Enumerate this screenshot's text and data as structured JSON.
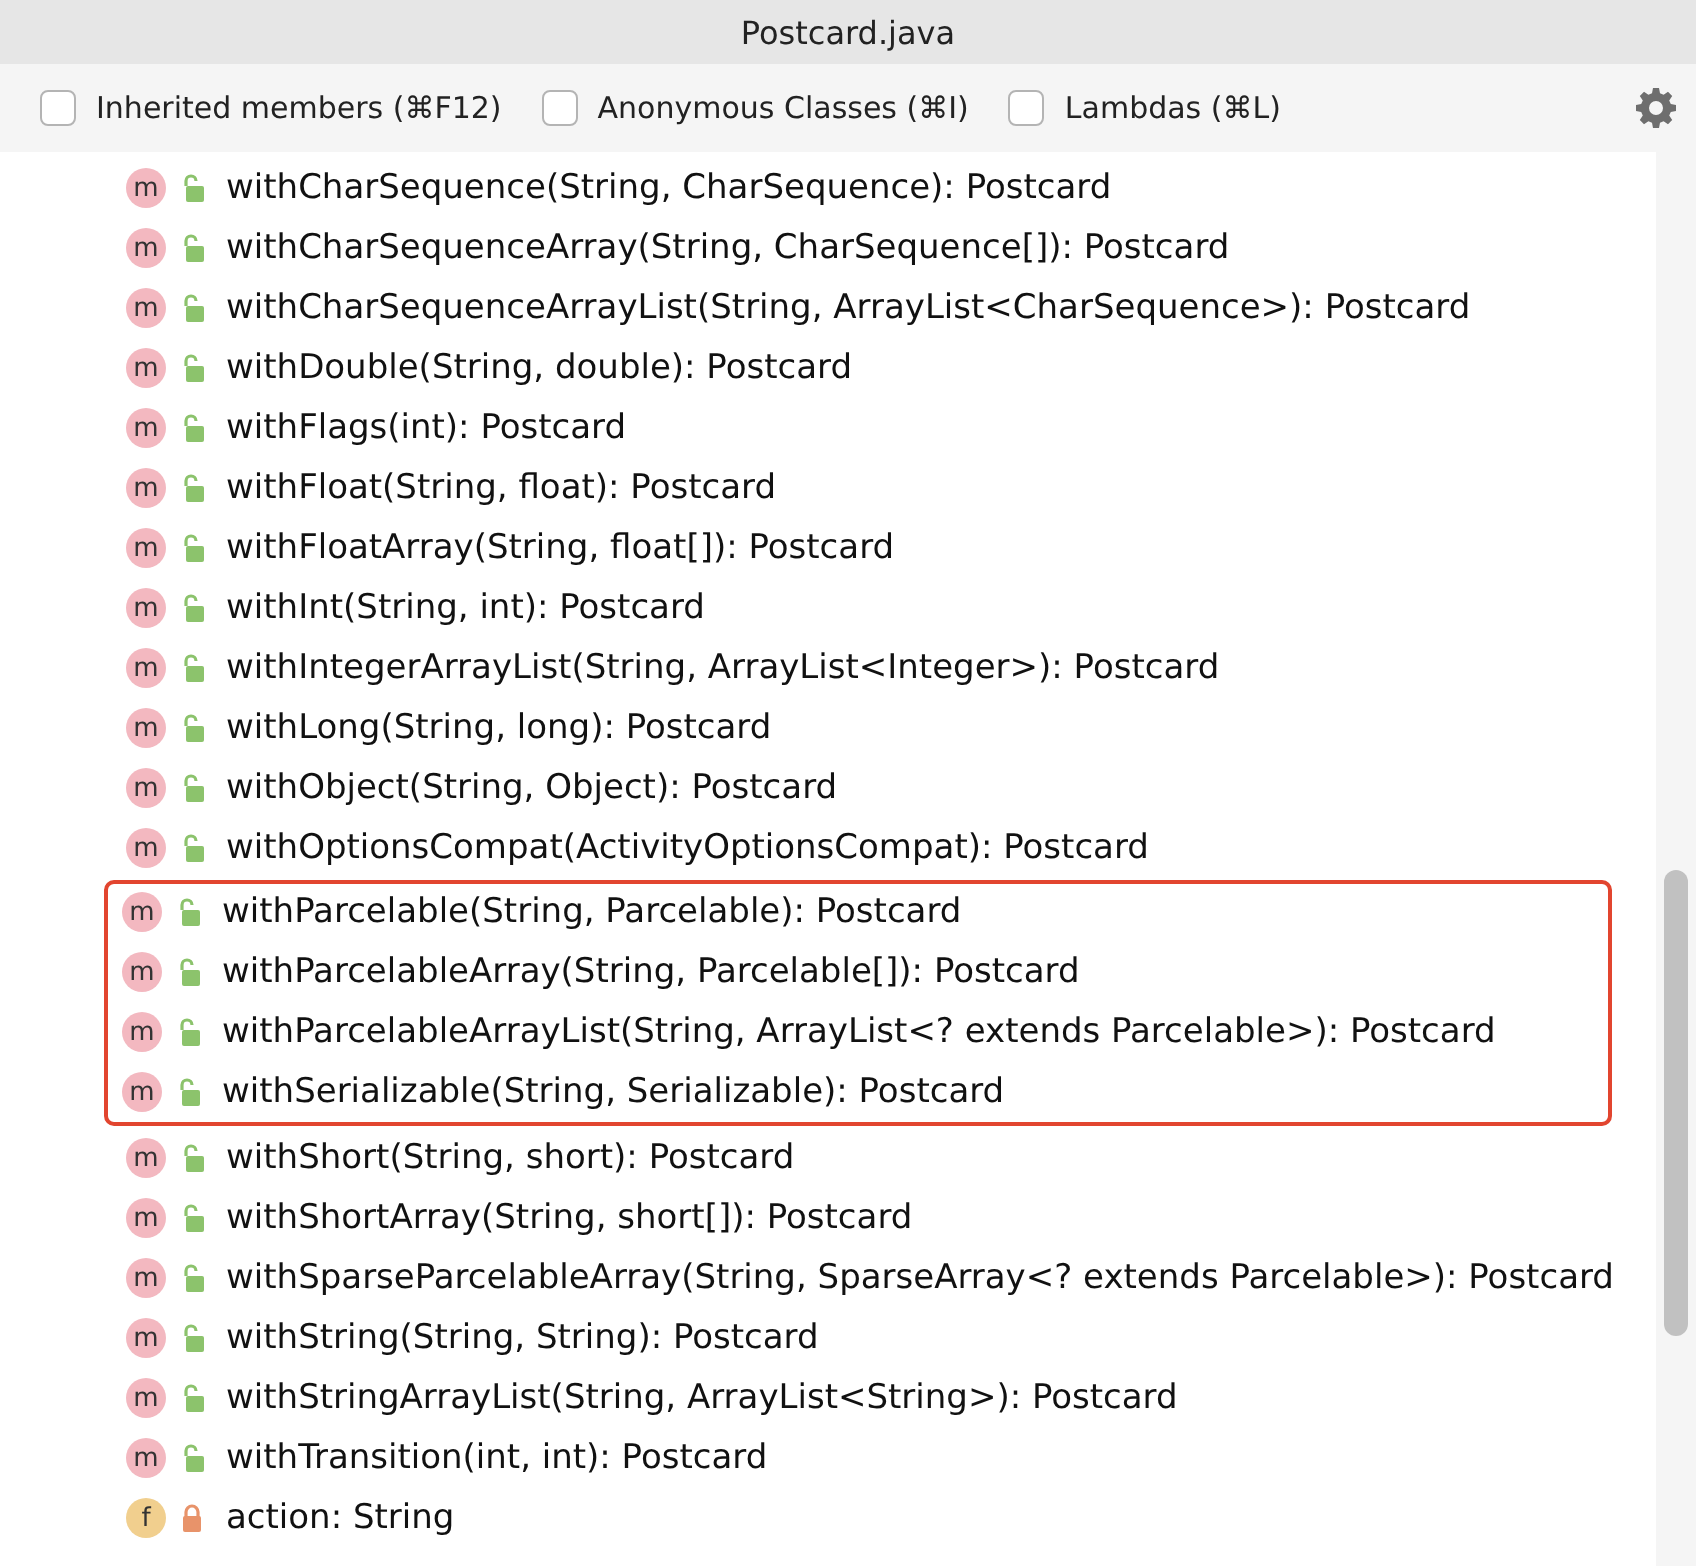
{
  "window": {
    "title": "Postcard.java"
  },
  "toolbar": {
    "options": [
      {
        "label": "Inherited members (⌘F12)",
        "checked": false
      },
      {
        "label": "Anonymous Classes (⌘I)",
        "checked": false
      },
      {
        "label": "Lambdas (⌘L)",
        "checked": false
      }
    ]
  },
  "members": [
    {
      "kind": "method",
      "badge": "m",
      "locked": false,
      "signature": "withCharSequence(String, CharSequence): Postcard",
      "highlighted": false
    },
    {
      "kind": "method",
      "badge": "m",
      "locked": false,
      "signature": "withCharSequenceArray(String, CharSequence[]): Postcard",
      "highlighted": false
    },
    {
      "kind": "method",
      "badge": "m",
      "locked": false,
      "signature": "withCharSequenceArrayList(String, ArrayList<CharSequence>): Postcard",
      "highlighted": false
    },
    {
      "kind": "method",
      "badge": "m",
      "locked": false,
      "signature": "withDouble(String, double): Postcard",
      "highlighted": false
    },
    {
      "kind": "method",
      "badge": "m",
      "locked": false,
      "signature": "withFlags(int): Postcard",
      "highlighted": false
    },
    {
      "kind": "method",
      "badge": "m",
      "locked": false,
      "signature": "withFloat(String, float): Postcard",
      "highlighted": false
    },
    {
      "kind": "method",
      "badge": "m",
      "locked": false,
      "signature": "withFloatArray(String, float[]): Postcard",
      "highlighted": false
    },
    {
      "kind": "method",
      "badge": "m",
      "locked": false,
      "signature": "withInt(String, int): Postcard",
      "highlighted": false
    },
    {
      "kind": "method",
      "badge": "m",
      "locked": false,
      "signature": "withIntegerArrayList(String, ArrayList<Integer>): Postcard",
      "highlighted": false
    },
    {
      "kind": "method",
      "badge": "m",
      "locked": false,
      "signature": "withLong(String, long): Postcard",
      "highlighted": false
    },
    {
      "kind": "method",
      "badge": "m",
      "locked": false,
      "signature": "withObject(String, Object): Postcard",
      "highlighted": false
    },
    {
      "kind": "method",
      "badge": "m",
      "locked": false,
      "signature": "withOptionsCompat(ActivityOptionsCompat): Postcard",
      "highlighted": false
    },
    {
      "kind": "method",
      "badge": "m",
      "locked": false,
      "signature": "withParcelable(String, Parcelable): Postcard",
      "highlighted": true
    },
    {
      "kind": "method",
      "badge": "m",
      "locked": false,
      "signature": "withParcelableArray(String, Parcelable[]): Postcard",
      "highlighted": true
    },
    {
      "kind": "method",
      "badge": "m",
      "locked": false,
      "signature": "withParcelableArrayList(String, ArrayList<? extends Parcelable>): Postcard",
      "highlighted": true
    },
    {
      "kind": "method",
      "badge": "m",
      "locked": false,
      "signature": "withSerializable(String, Serializable): Postcard",
      "highlighted": true
    },
    {
      "kind": "method",
      "badge": "m",
      "locked": false,
      "signature": "withShort(String, short): Postcard",
      "highlighted": false
    },
    {
      "kind": "method",
      "badge": "m",
      "locked": false,
      "signature": "withShortArray(String, short[]): Postcard",
      "highlighted": false
    },
    {
      "kind": "method",
      "badge": "m",
      "locked": false,
      "signature": "withSparseParcelableArray(String, SparseArray<? extends Parcelable>): Postcard",
      "highlighted": false
    },
    {
      "kind": "method",
      "badge": "m",
      "locked": false,
      "signature": "withString(String, String): Postcard",
      "highlighted": false
    },
    {
      "kind": "method",
      "badge": "m",
      "locked": false,
      "signature": "withStringArrayList(String, ArrayList<String>): Postcard",
      "highlighted": false
    },
    {
      "kind": "method",
      "badge": "m",
      "locked": false,
      "signature": "withTransition(int, int): Postcard",
      "highlighted": false
    },
    {
      "kind": "field",
      "badge": "f",
      "locked": true,
      "signature": "action: String",
      "highlighted": false
    }
  ]
}
